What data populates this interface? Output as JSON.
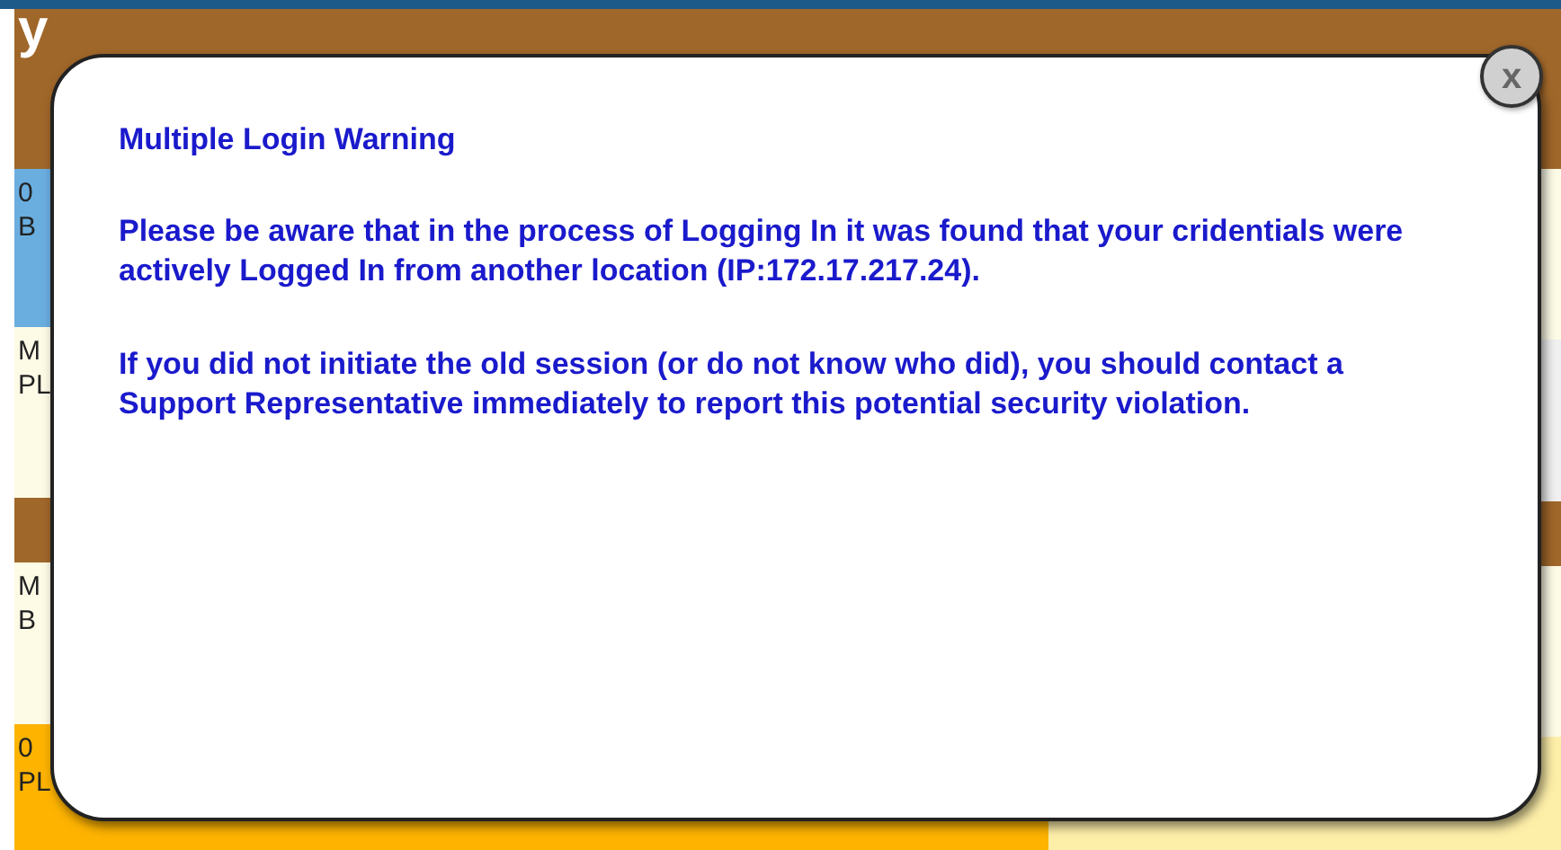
{
  "calendar": {
    "headers": [
      "y"
    ],
    "left_cells": [
      {
        "lines": [
          "0",
          "B"
        ],
        "kind": "blue"
      },
      {
        "lines": [
          "M",
          "PL"
        ],
        "kind": "cream"
      },
      {
        "lines": [
          "M",
          "B"
        ],
        "kind": "cream"
      },
      {
        "lines": [
          "0",
          "PL"
        ],
        "kind": "orange"
      }
    ]
  },
  "dialog": {
    "title": "Multiple Login Warning",
    "paragraphs": [
      "Please be aware that in the process of Logging In it was found that your cridentials were actively Logged In from another location (IP:172.17.217.24).",
      "If you did not initiate the old session (or do not know who did), you should contact a Support Representative immediately to report this potential security violation."
    ],
    "close_label": "x"
  }
}
